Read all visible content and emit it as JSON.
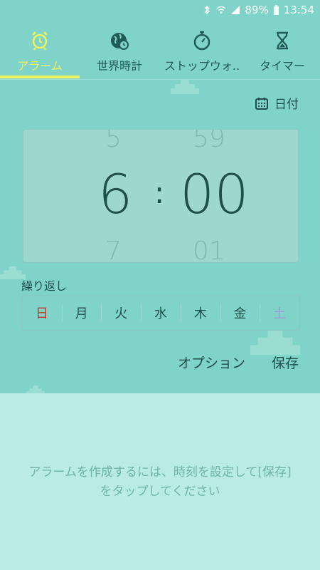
{
  "status_bar": {
    "battery_percent": "89%",
    "time": "13:54"
  },
  "tabs": [
    {
      "label": "アラーム",
      "icon": "alarm-clock-icon",
      "active": true
    },
    {
      "label": "世界時計",
      "icon": "globe-clock-icon",
      "active": false
    },
    {
      "label": "ストップウォ..",
      "icon": "stopwatch-icon",
      "active": false
    },
    {
      "label": "タイマー",
      "icon": "hourglass-icon",
      "active": false
    }
  ],
  "date_button": {
    "label": "日付",
    "icon": "calendar-icon"
  },
  "time_picker": {
    "hour_prev": "5",
    "hour": "6",
    "hour_next": "7",
    "separator": ":",
    "minute_prev": "59",
    "minute": "00",
    "minute_next": "01"
  },
  "repeat": {
    "label": "繰り返し",
    "days": [
      "日",
      "月",
      "火",
      "水",
      "木",
      "金",
      "土"
    ]
  },
  "actions": {
    "options_label": "オプション",
    "save_label": "保存"
  },
  "hint_text": "アラームを作成するには、時刻を設定して[保存]をタップしてください",
  "colors": {
    "accent": "#eef35a",
    "background": "#7fd3c8",
    "text_dark": "#1f4f4a",
    "sunday": "#c0392b",
    "saturday": "#9b9fd8"
  }
}
